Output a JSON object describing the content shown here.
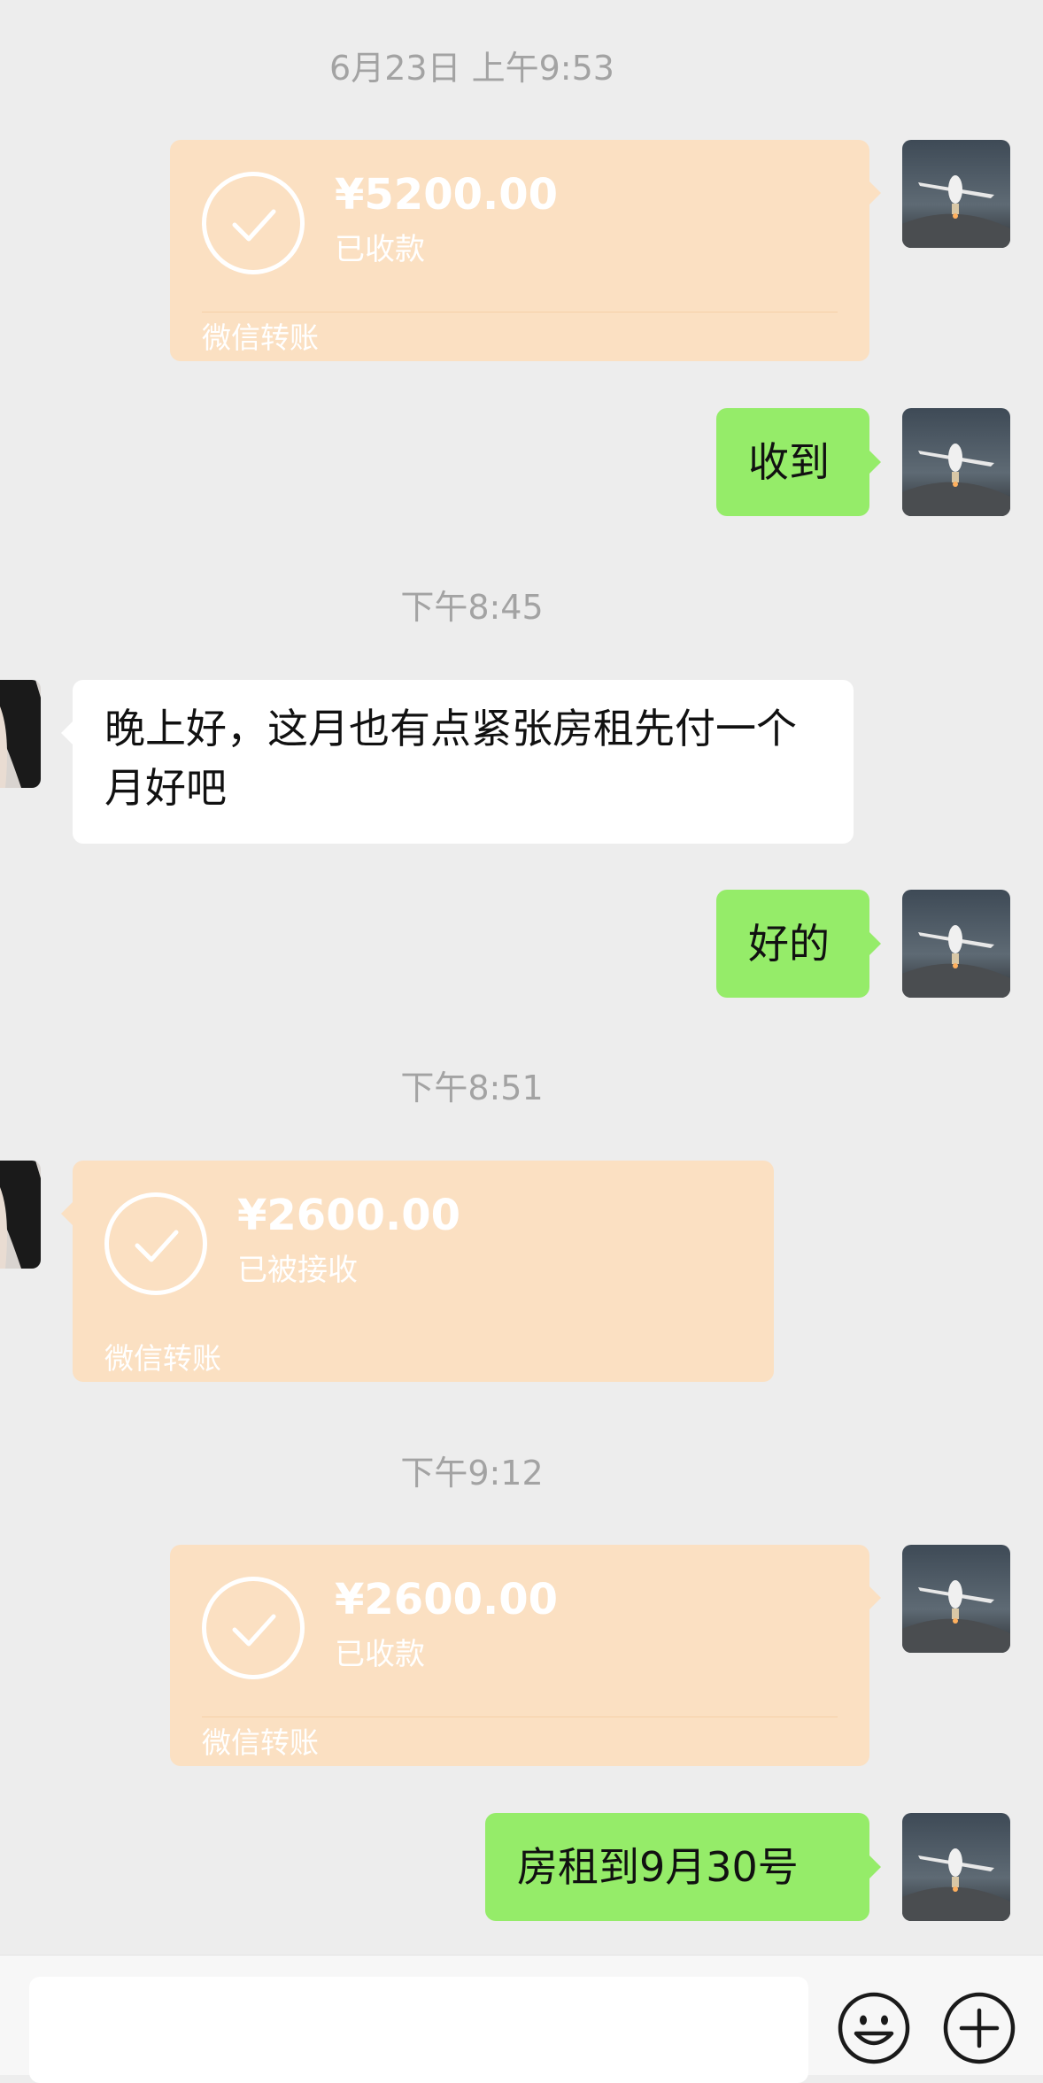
{
  "timestamps": [
    "6月23日 上午9:53",
    "下午8:45",
    "下午8:51",
    "下午9:12"
  ],
  "messages": {
    "t1": {
      "amount": "¥5200.00",
      "status": "已收款",
      "label": "微信转账"
    },
    "m1": {
      "text": "收到"
    },
    "m2": {
      "text": "晚上好，这月也有点紧张房租先付一个月好吧"
    },
    "m3": {
      "text": "好的"
    },
    "t2": {
      "amount": "¥2600.00",
      "status": "已被接收",
      "label": "微信转账"
    },
    "t3": {
      "amount": "¥2600.00",
      "status": "已收款",
      "label": "微信转账"
    },
    "m4": {
      "text": "房租到9月30号"
    }
  },
  "icons": {
    "emoji": "emoji-icon",
    "plus": "plus-icon",
    "check": "check-icon"
  },
  "colors": {
    "background": "#ededed",
    "sent_bubble": "#95ec69",
    "received_bubble": "#ffffff",
    "transfer_card": "#fbe0c2"
  }
}
